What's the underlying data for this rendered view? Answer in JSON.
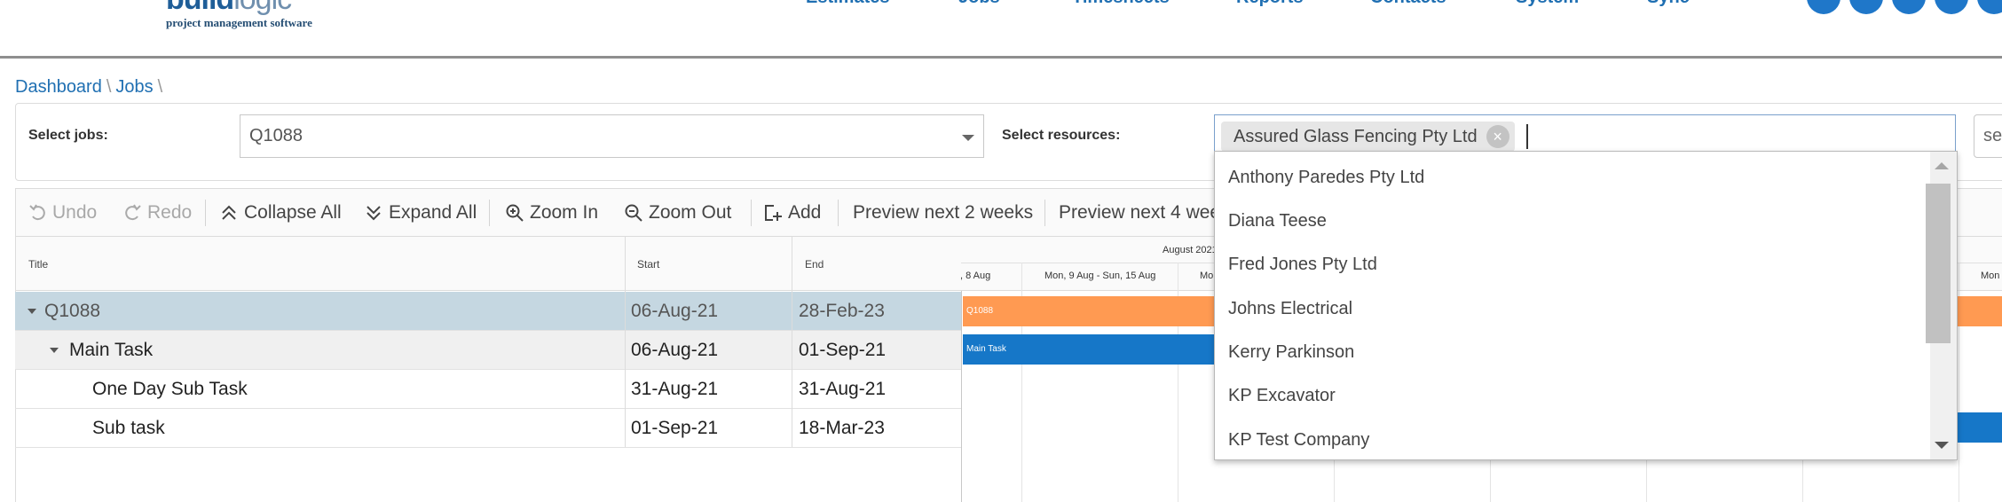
{
  "header": {
    "logo": {
      "main_bold": "build",
      "main_light": "logic",
      "tagline": "project management software"
    },
    "nav": [
      "Estimates",
      "Jobs",
      "Timesheets",
      "Reports",
      "Contacts",
      "System",
      "Sync"
    ],
    "accent_color": "#1f77c9"
  },
  "breadcrumb": {
    "items": [
      "Dashboard",
      "Jobs"
    ],
    "separator": "\\"
  },
  "filters": {
    "jobs_label": "Select jobs:",
    "jobs_value": "Q1088",
    "resources_label": "Select resources:",
    "selected_resource": "Assured Glass Fencing Pty Ltd",
    "chip_remove_glyph": "×",
    "search_button": "se"
  },
  "toolbar": {
    "undo": "Undo",
    "redo": "Redo",
    "collapse_all": "Collapse All",
    "expand_all": "Expand All",
    "zoom_in": "Zoom In",
    "zoom_out": "Zoom Out",
    "add": "Add",
    "preview_2": "Preview next 2 weeks",
    "preview_4": "Preview next 4 wee"
  },
  "grid": {
    "columns": [
      "Title",
      "Start",
      "End"
    ],
    "rows": [
      {
        "title": "Q1088",
        "start": "06-Aug-21",
        "end": "28-Feb-23",
        "level": 0,
        "expandable": true,
        "selected": true
      },
      {
        "title": "Main Task",
        "start": "06-Aug-21",
        "end": "01-Sep-21",
        "level": 1,
        "expandable": true
      },
      {
        "title": "One Day Sub Task",
        "start": "31-Aug-21",
        "end": "31-Aug-21",
        "level": 2,
        "expandable": false
      },
      {
        "title": "Sub task",
        "start": "01-Sep-21",
        "end": "18-Mar-23",
        "level": 2,
        "expandable": false
      }
    ]
  },
  "timeline": {
    "month": "August 2021",
    "weeks": [
      ", 8 Aug",
      "Mon, 9 Aug - Sun, 15 Aug",
      "Mo",
      "Mon"
    ],
    "bars": [
      {
        "label": "Q1088",
        "color": "#ff9a52"
      },
      {
        "label": "Main Task",
        "color": "#1677c8"
      },
      {
        "label": "",
        "color": "#1677c8"
      }
    ]
  },
  "dropdown": {
    "options": [
      "Anthony Paredes Pty Ltd",
      "Diana Teese",
      "Fred Jones Pty Ltd",
      "Johns Electrical",
      "Kerry Parkinson",
      "KP Excavator",
      "KP Test Company"
    ]
  }
}
